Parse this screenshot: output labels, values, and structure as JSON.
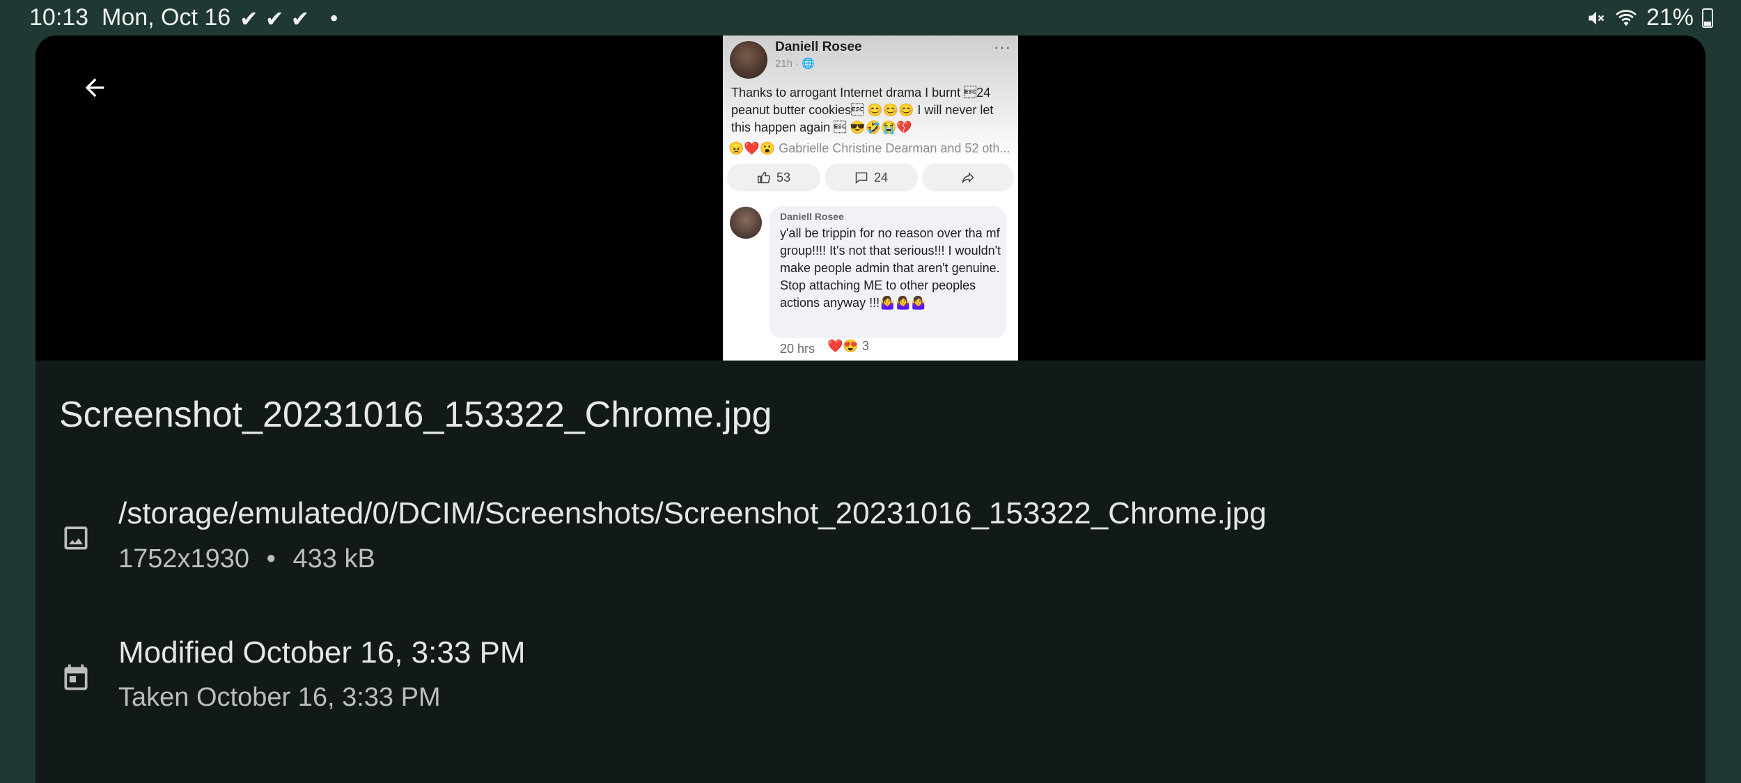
{
  "status_bar": {
    "time": "10:13",
    "date": "Mon, Oct 16",
    "checks": "✔✔✔",
    "dot": "•",
    "battery_percent": "21%"
  },
  "preview": {
    "post": {
      "author": "Daniell Rosee",
      "meta": "21h · 🌐",
      "more": "···",
      "text": "Thanks to arrogant Internet drama I burnt \u001b24 peanut butter cookies\u001b 😊😊😊 I will never let this happen again \u001b 😎🤣😭💔",
      "reactions_emoji": "😠❤️😮",
      "reactions_text": "Gabrielle Christine Dearman and 52 oth...",
      "likes": "53",
      "comments": "24"
    },
    "comment": {
      "author": "Daniell Rosee",
      "text": "y'all be trippin for no reason over tha mf group!!!! It's not that serious!!! I wouldn't make people admin that aren't genuine. Stop attaching ME to other peoples actions anyway !!!🤷‍♀️🤷‍♀️🤷‍♀️",
      "time": "20 hrs",
      "reactions_emoji": "❤️😍",
      "reaction_count": "3"
    }
  },
  "details": {
    "filename": "Screenshot_20231016_153322_Chrome.jpg",
    "path": "/storage/emulated/0/DCIM/Screenshots/Screenshot_20231016_153322_Chrome.jpg",
    "dimensions": "1752x1930",
    "separator": "•",
    "size": "433 kB",
    "modified": "Modified October 16, 3:33 PM",
    "taken": "Taken October 16, 3:33 PM"
  },
  "icons": {
    "back": "arrow-left-icon",
    "image": "image-icon",
    "calendar": "calendar-icon",
    "mute": "volume-mute-icon",
    "wifi": "wifi-icon",
    "battery": "battery-icon"
  }
}
